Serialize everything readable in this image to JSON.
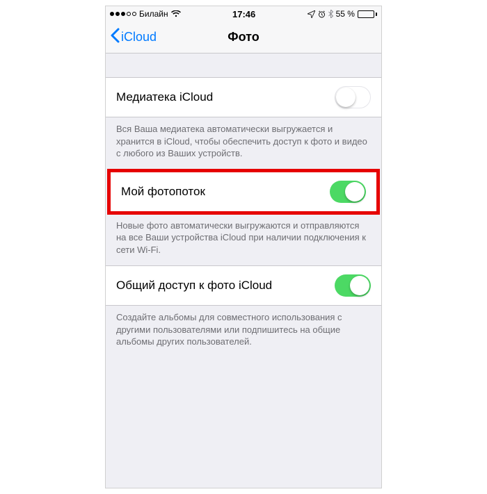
{
  "status": {
    "carrier": "Билайн",
    "time": "17:46",
    "battery_pct_text": "55 %",
    "battery_pct": 55,
    "signal_filled": 3,
    "signal_total": 5
  },
  "nav": {
    "back_label": "iCloud",
    "title": "Фото"
  },
  "sections": {
    "library": {
      "label": "Медиатека iCloud",
      "description": "Вся Ваша медиатека автоматически выгружается и хранится в iCloud, чтобы обеспечить доступ к фото и видео с любого из Ваших устройств.",
      "on": false
    },
    "photostream": {
      "label": "Мой фотопоток",
      "description": "Новые фото автоматически выгружаются и отправляются на все Ваши устройства iCloud при наличии подключения к сети Wi-Fi.",
      "on": true
    },
    "sharing": {
      "label": "Общий доступ к фото iCloud",
      "description": "Создайте альбомы для совместного использования с другими пользователями или подпишитесь на общие альбомы других пользователей.",
      "on": true
    }
  }
}
